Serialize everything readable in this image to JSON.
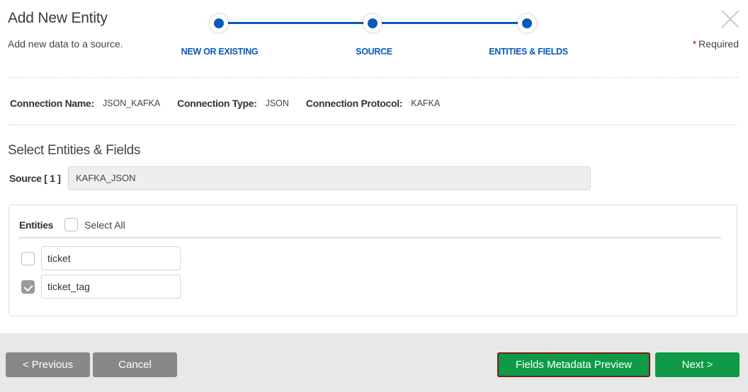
{
  "header": {
    "title": "Add New Entity",
    "subtitle": "Add new data to a source.",
    "required_star": "*",
    "required_label": "Required",
    "close_icon": "close-x-icon"
  },
  "stepper": {
    "color": "#0a59b8",
    "steps": [
      {
        "label": "NEW OR EXISTING",
        "state": "complete"
      },
      {
        "label": "SOURCE",
        "state": "complete"
      },
      {
        "label": "ENTITIES & FIELDS",
        "state": "current"
      }
    ]
  },
  "connection": {
    "name_label": "Connection Name:",
    "name_value": "JSON_KAFKA",
    "type_label": "Connection Type:",
    "type_value": "JSON",
    "protocol_label": "Connection Protocol:",
    "protocol_value": "KAFKA"
  },
  "section": {
    "title": "Select Entities & Fields",
    "source_label": "Source [ 1 ]",
    "source_value": "KAFKA_JSON"
  },
  "entities": {
    "header": "Entities",
    "select_all_label": "Select All",
    "select_all_checked": false,
    "items": [
      {
        "name": "ticket",
        "checked": false
      },
      {
        "name": "ticket_tag",
        "checked": true
      }
    ]
  },
  "footer": {
    "previous_label": "< Previous",
    "cancel_label": "Cancel",
    "preview_label": "Fields Metadata Preview",
    "next_label": "Next >",
    "primary_color": "#0e9a47",
    "secondary_color": "#888888"
  }
}
